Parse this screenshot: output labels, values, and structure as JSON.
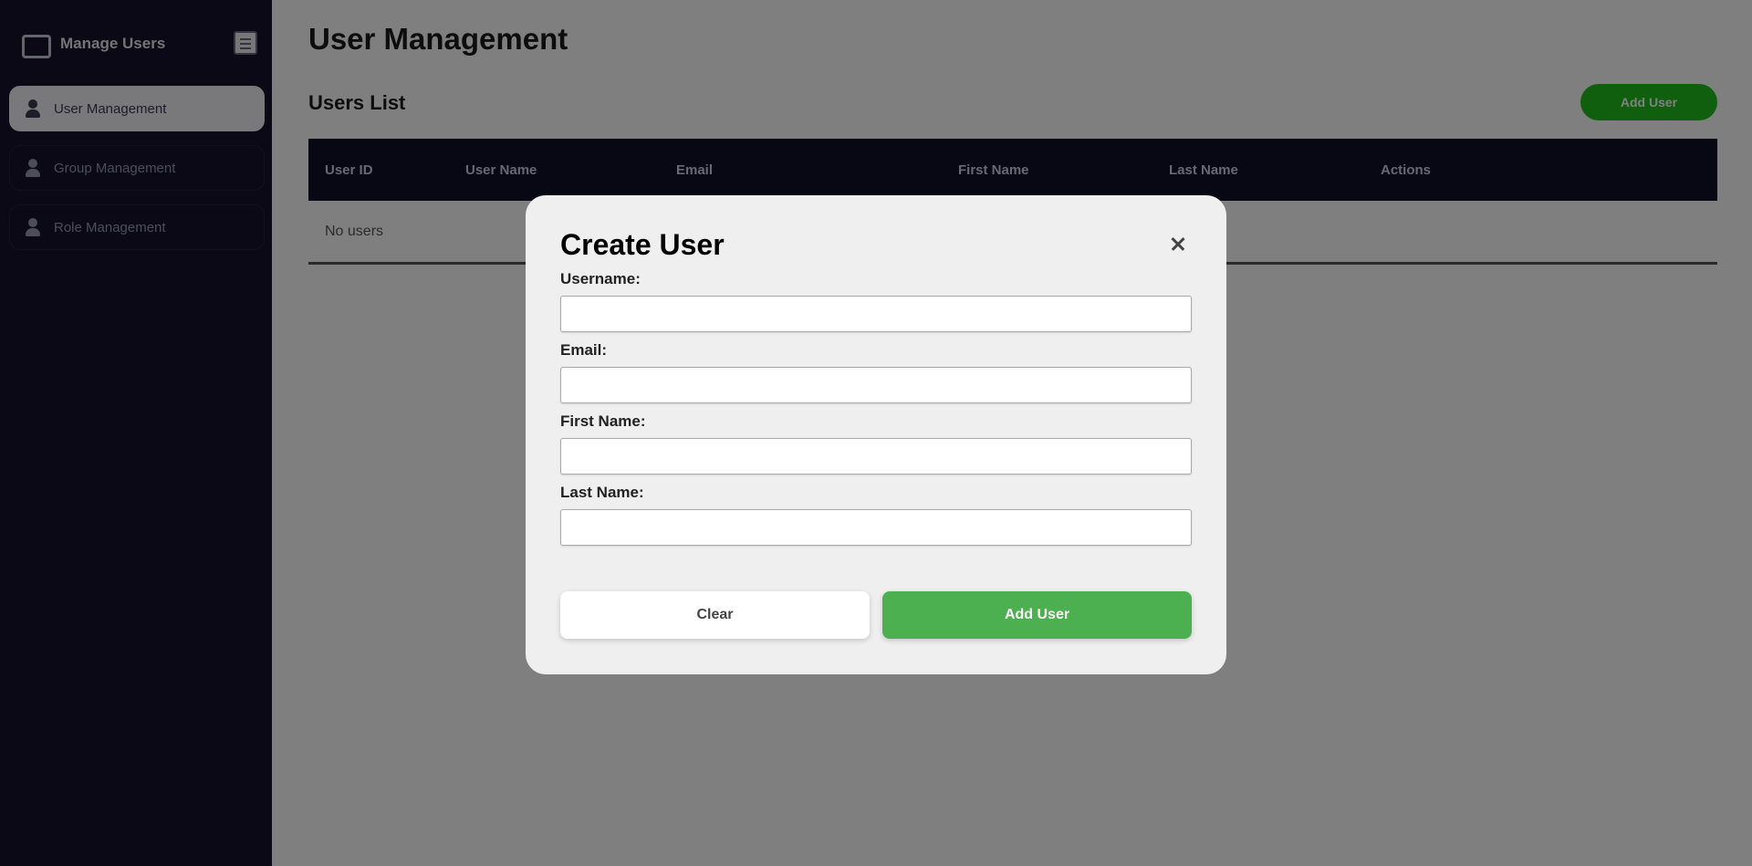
{
  "sidebar": {
    "brand_title": "Manage Users",
    "items": [
      {
        "label": "User Management"
      },
      {
        "label": "Group Management"
      },
      {
        "label": "Role Management"
      }
    ]
  },
  "main": {
    "page_title": "User Management",
    "section_title": "Users List",
    "add_user_label": "Add User",
    "table": {
      "columns": [
        "User ID",
        "User Name",
        "Email",
        "First Name",
        "Last Name",
        "Actions"
      ],
      "empty_text": "No users"
    }
  },
  "modal": {
    "title": "Create User",
    "fields": [
      {
        "label": "Username:",
        "value": "",
        "placeholder": ""
      },
      {
        "label": "Email:",
        "value": "",
        "placeholder": ""
      },
      {
        "label": "First Name:",
        "value": "",
        "placeholder": ""
      },
      {
        "label": "Last Name:",
        "value": "",
        "placeholder": ""
      }
    ],
    "clear_label": "Clear",
    "submit_label": "Add User"
  },
  "colors": {
    "sidebar_bg": "#14122a",
    "table_header_bg": "#11102b",
    "primary_green": "#4caf50",
    "top_button_green": "#1fbf1f",
    "modal_bg": "#efefef"
  }
}
